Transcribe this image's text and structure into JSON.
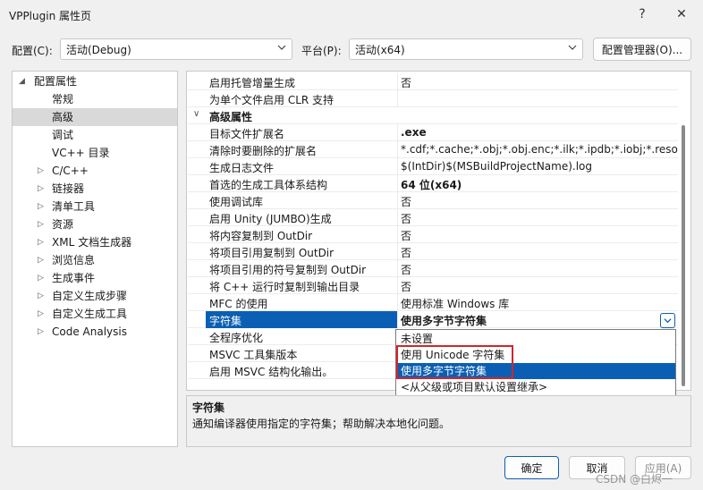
{
  "window": {
    "title": "VPPlugin 属性页",
    "help_glyph": "?",
    "close_glyph": "✕"
  },
  "config_row": {
    "config_label": "配置(C):",
    "config_value": "活动(Debug)",
    "platform_label": "平台(P):",
    "platform_value": "活动(x64)",
    "manager_button": "配置管理器(O)..."
  },
  "tree": {
    "root": "配置属性",
    "items": [
      {
        "label": "常规",
        "expandable": false
      },
      {
        "label": "高级",
        "expandable": false,
        "selected": true
      },
      {
        "label": "调试",
        "expandable": false
      },
      {
        "label": "VC++ 目录",
        "expandable": false
      },
      {
        "label": "C/C++",
        "expandable": true
      },
      {
        "label": "链接器",
        "expandable": true
      },
      {
        "label": "清单工具",
        "expandable": true
      },
      {
        "label": "资源",
        "expandable": true
      },
      {
        "label": "XML 文档生成器",
        "expandable": true
      },
      {
        "label": "浏览信息",
        "expandable": true
      },
      {
        "label": "生成事件",
        "expandable": true
      },
      {
        "label": "自定义生成步骤",
        "expandable": true
      },
      {
        "label": "自定义生成工具",
        "expandable": true
      },
      {
        "label": "Code Analysis",
        "expandable": true
      }
    ]
  },
  "grid": {
    "top_rows": [
      {
        "name": "启用托管增量生成",
        "value": "否"
      },
      {
        "name": "为单个文件启用 CLR 支持",
        "value": ""
      }
    ],
    "category": "高级属性",
    "rows": [
      {
        "name": "目标文件扩展名",
        "value": ".exe",
        "bold": true
      },
      {
        "name": "清除时要删除的扩展名",
        "value": "*.cdf;*.cache;*.obj;*.obj.enc;*.ilk;*.ipdb;*.iobj;*.resources"
      },
      {
        "name": "生成日志文件",
        "value": "$(IntDir)$(MSBuildProjectName).log"
      },
      {
        "name": "首选的生成工具体系结构",
        "value": "64 位(x64)",
        "bold": true
      },
      {
        "name": "使用调试库",
        "value": "否"
      },
      {
        "name": "启用 Unity (JUMBO)生成",
        "value": "否"
      },
      {
        "name": "将内容复制到 OutDir",
        "value": "否"
      },
      {
        "name": "将项目引用复制到 OutDir",
        "value": "否"
      },
      {
        "name": "将项目引用的符号复制到 OutDir",
        "value": "否"
      },
      {
        "name": "将 C++ 运行时复制到输出目录",
        "value": "否"
      },
      {
        "name": "MFC 的使用",
        "value": "使用标准 Windows 库"
      },
      {
        "name": "字符集",
        "value": "使用多字节字符集",
        "bold": true,
        "selected": true
      },
      {
        "name": "全程序优化",
        "value": ""
      },
      {
        "name": "MSVC 工具集版本",
        "value": ""
      },
      {
        "name": "启用 MSVC 结构化输出。",
        "value": ""
      }
    ]
  },
  "dropdown": {
    "options": [
      {
        "label": "未设置"
      },
      {
        "label": "使用 Unicode 字符集"
      },
      {
        "label": "使用多字节字符集",
        "highlighted": true
      },
      {
        "label": "<从父级或项目默认设置继承>"
      }
    ]
  },
  "description": {
    "title": "字符集",
    "text": "通知编译器使用指定的字符集；帮助解决本地化问题。"
  },
  "buttons": {
    "ok": "确定",
    "cancel": "取消",
    "apply": "应用(A)"
  },
  "watermark": "CSDN @白烬一",
  "colors": {
    "selection": "#0a5fb4",
    "highlight_box": "#d0262a"
  }
}
